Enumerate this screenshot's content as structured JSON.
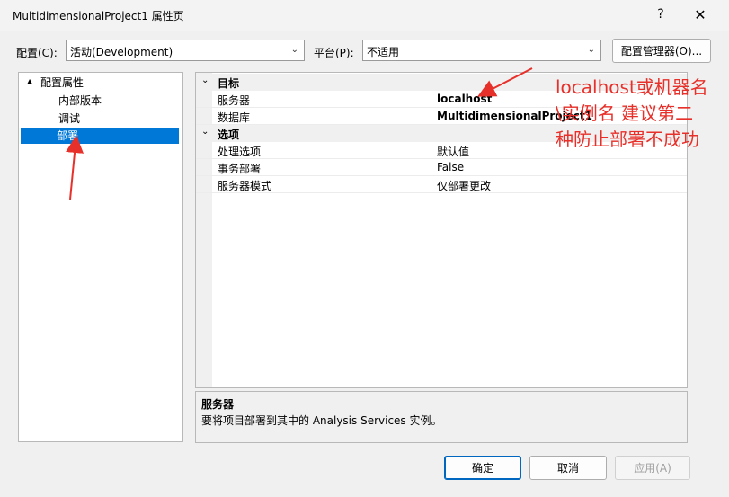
{
  "window": {
    "title": "MultidimensionalProject1 属性页",
    "help": "?",
    "close": "✕"
  },
  "toolbar": {
    "config_label": "配置(C):",
    "config_value": "活动(Development)",
    "platform_label": "平台(P):",
    "platform_value": "不适用",
    "config_manager": "配置管理器(O)..."
  },
  "tree": {
    "root": "配置属性",
    "items": [
      "内部版本",
      "调试",
      "部署"
    ],
    "selected": "部署"
  },
  "grid": {
    "categories": [
      {
        "name": "目标",
        "rows": [
          {
            "name": "服务器",
            "value": "localhost"
          },
          {
            "name": "数据库",
            "value": "MultidimensionalProject1"
          }
        ]
      },
      {
        "name": "选项",
        "rows": [
          {
            "name": "处理选项",
            "value": "默认值"
          },
          {
            "name": "事务部署",
            "value": "False"
          },
          {
            "name": "服务器模式",
            "value": "仅部署更改"
          }
        ]
      }
    ]
  },
  "description": {
    "title": "服务器",
    "text": "要将项目部署到其中的 Analysis Services 实例。"
  },
  "annotation": {
    "line1": "localhost或机器名",
    "line2": "\\实例名  建议第二",
    "line3": "种防止部署不成功",
    "color": "#e8302a"
  },
  "buttons": {
    "ok": "确定",
    "cancel": "取消",
    "apply": "应用(A)"
  },
  "icons": {
    "collapse": "▲",
    "dropdown": "chevron-down-icon"
  }
}
